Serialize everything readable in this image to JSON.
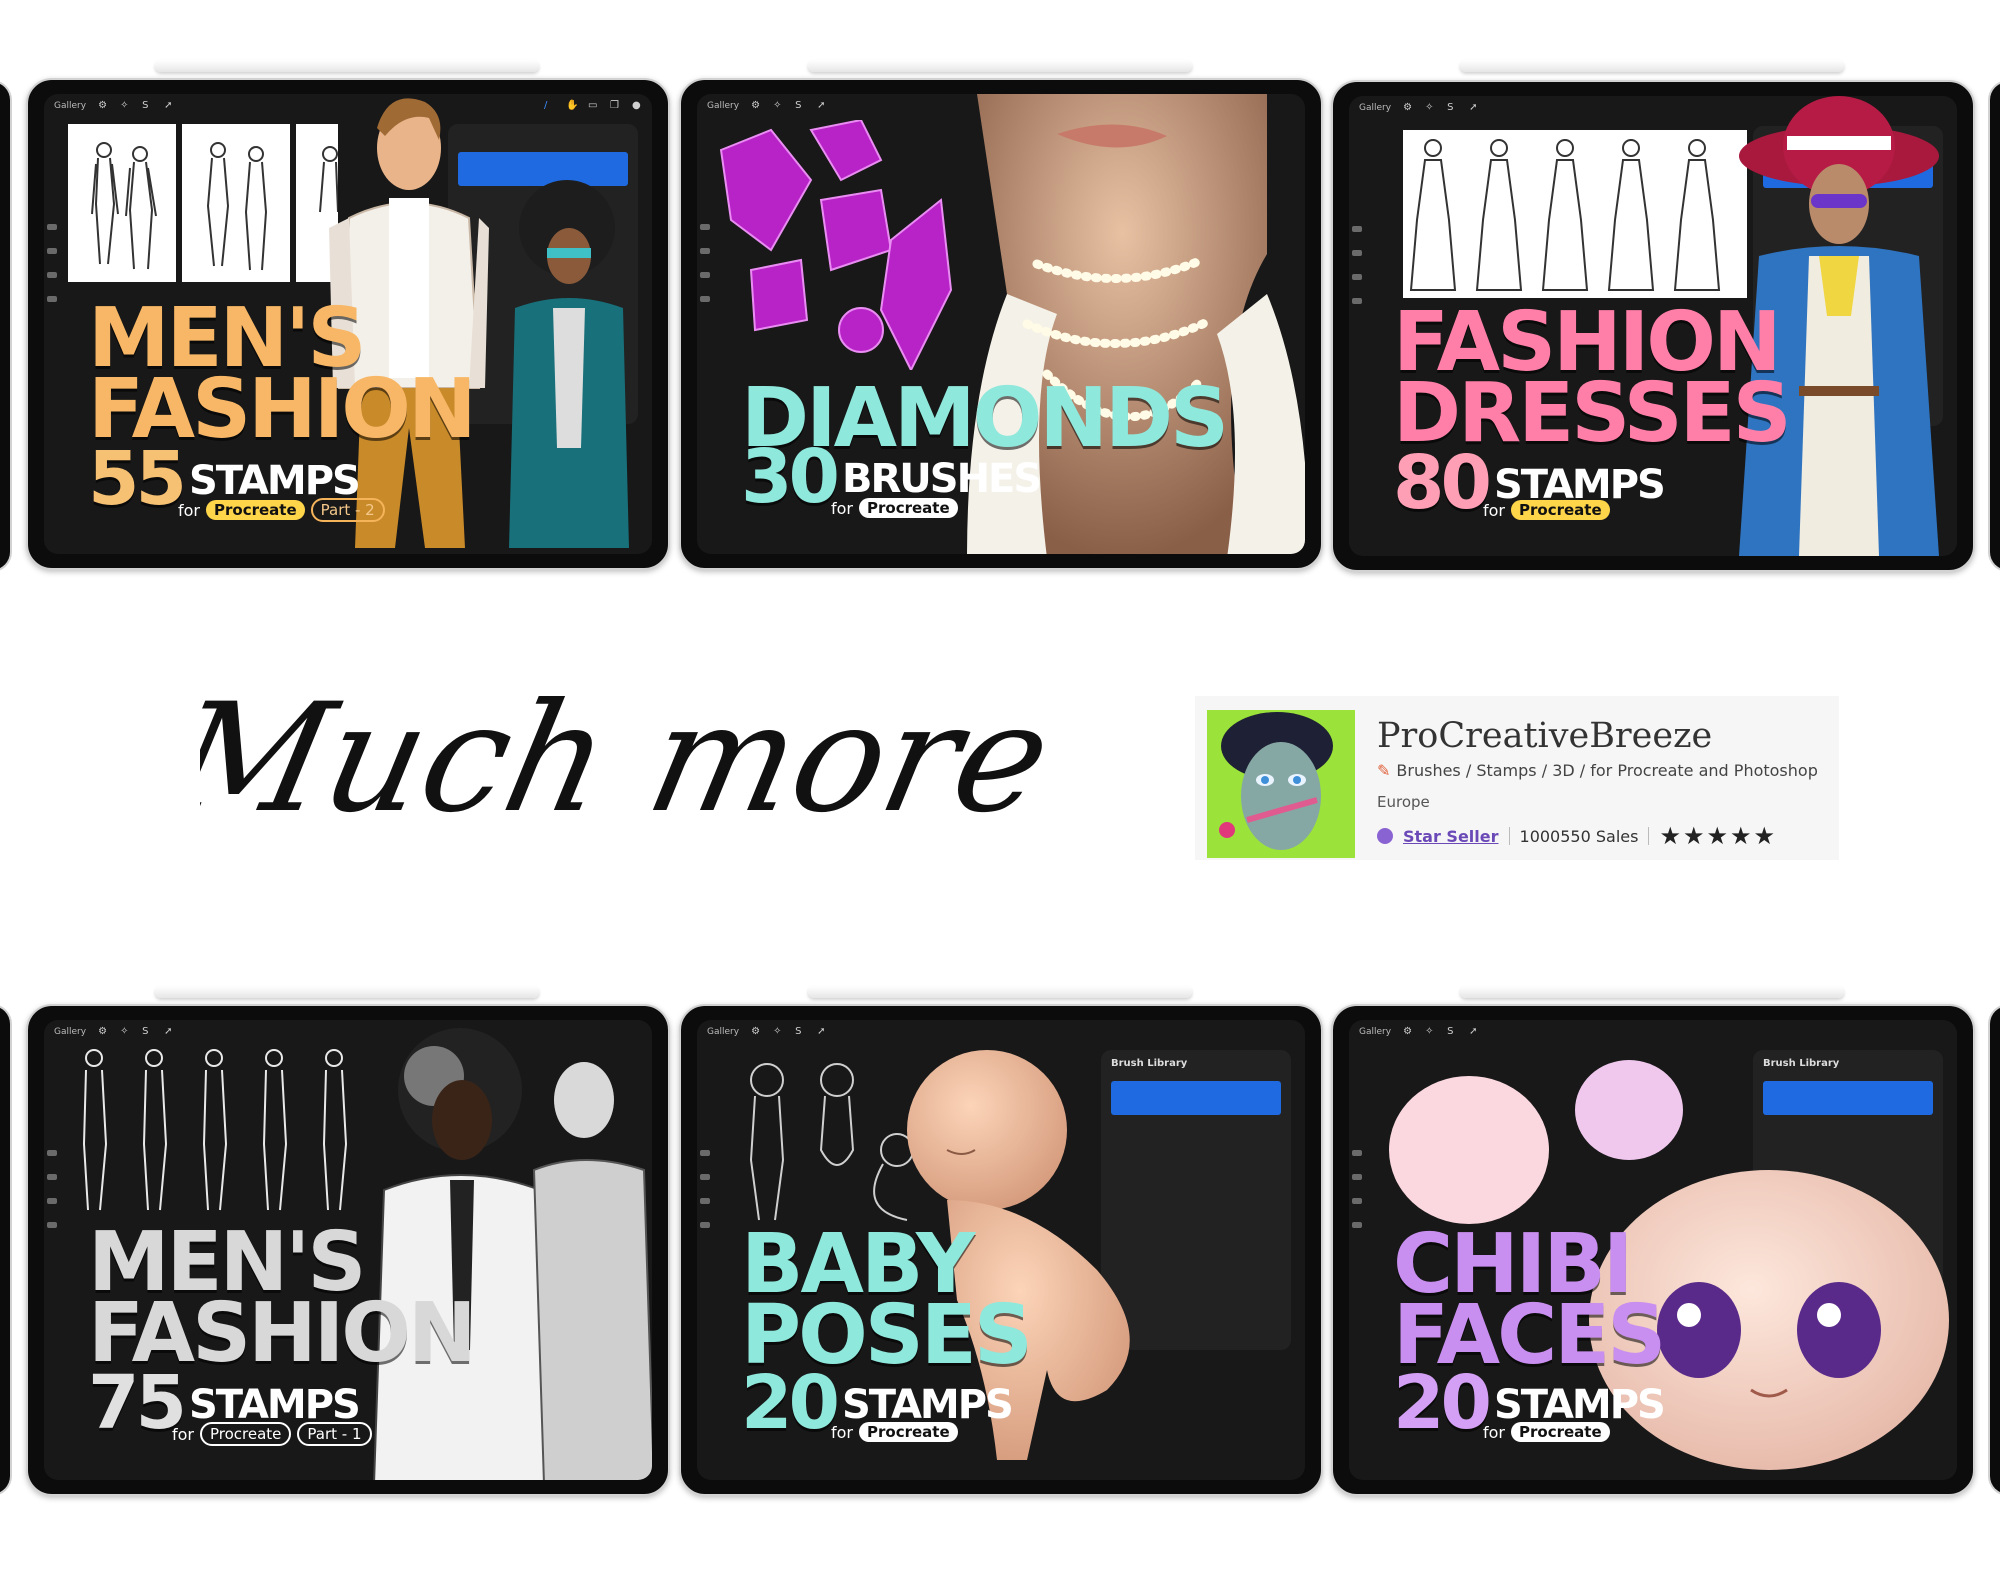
{
  "heading": "Much more",
  "products": [
    {
      "title_lines": [
        "MEN'S",
        "FASHION"
      ],
      "count": "55",
      "unit": "STAMPS",
      "for_word": "for",
      "app": "Procreate",
      "part": "Part - 2",
      "title_color": "#f7b766",
      "num_color": "#f7c173"
    },
    {
      "title_lines": [
        "DIAMONDS"
      ],
      "count": "30",
      "unit": "BRUSHES",
      "for_word": "for",
      "app": "Procreate",
      "part": "",
      "title_color": "#8fe8dc",
      "num_color": "#8fe8dc"
    },
    {
      "title_lines": [
        "FASHION",
        "DRESSES"
      ],
      "count": "80",
      "unit": "STAMPS",
      "for_word": "for",
      "app": "Procreate",
      "part": "",
      "title_color": "#ff7fa8",
      "num_color": "#ff9fb5"
    },
    {
      "title_lines": [
        "MEN'S",
        "FASHION"
      ],
      "count": "75",
      "unit": "STAMPS",
      "for_word": "for",
      "app": "Procreate",
      "part": "Part - 1",
      "title_color": "#d8d8d8",
      "num_color": "#e0e0e0"
    },
    {
      "title_lines": [
        "BABY",
        "POSES"
      ],
      "count": "20",
      "unit": "STAMPS",
      "for_word": "for",
      "app": "Procreate",
      "part": "",
      "title_color": "#8fe8dc",
      "num_color": "#8fe8dc"
    },
    {
      "title_lines": [
        "CHIBI",
        "FACES"
      ],
      "count": "20",
      "unit": "STAMPS",
      "for_word": "for",
      "app": "Procreate",
      "part": "",
      "title_color": "#c98ff0",
      "num_color": "#d4a0f5"
    }
  ],
  "ui": {
    "gallery_label": "Gallery",
    "brush_library_label": "Brush Library"
  },
  "shop": {
    "name": "ProCreativeBreeze",
    "tagline": "Brushes / Stamps / 3D / for Procreate and Photoshop",
    "region": "Europe",
    "badge": "Star Seller",
    "sales": "1000550 Sales",
    "stars": "★★★★★",
    "rating": 5
  }
}
